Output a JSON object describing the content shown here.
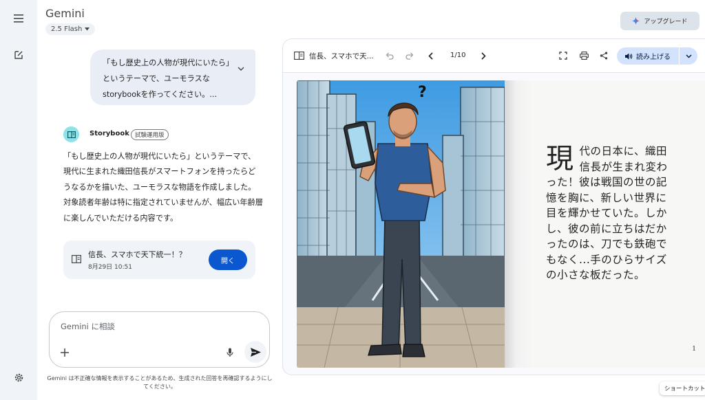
{
  "app": {
    "title": "Gemini",
    "model": "2.5 Flash",
    "upgrade_label": "アップグレード"
  },
  "chat": {
    "user_message": "「もし歴史上の人物が現代にいたら」というテーマで、ユーモラスなstorybookを作ってください。...",
    "response_name": "Storybook",
    "response_badge": "試験運用版",
    "response_text": "「もし歴史上の人物が現代にいたら」というテーマで、現代に生まれた織田信長がスマートフォンを持ったらどうなるかを描いた、ユーモラスな物語を作成しました。対象読者年齢は特に指定されていませんが、幅広い年齢層に楽しんでいただける内容です。",
    "book_card": {
      "title": "信長、スマホで天下統一！？",
      "date": "8月29日 10:51",
      "open_label": "開く"
    }
  },
  "input": {
    "placeholder": "Gemini に相談",
    "disclaimer": "Gemini は不正確な情報を表示することがあるため、生成された回答を再確認するようにしてください。"
  },
  "story": {
    "toolbar_title": "信長、スマホで天...",
    "page_indicator": "1/10",
    "read_aloud_label": "読み上げる",
    "dropcap": "現",
    "text": "代の日本に、織田信長が生まれ変わった！彼は戦国の世の記憶を胸に、新しい世界に目を輝かせていた。しかし、彼の前に立ちはだかったのは、刀でも鉄砲でもなく...手のひらサイズの小さな板だった。",
    "page_number": "1",
    "question_mark": "?"
  },
  "shortcut_label": "ショートカット",
  "colors": {
    "accent": "#0b57d0",
    "rail_bg": "#f0f4f9",
    "read_btn_bg": "#d3e3fd",
    "sky": "#4ea9e8"
  }
}
